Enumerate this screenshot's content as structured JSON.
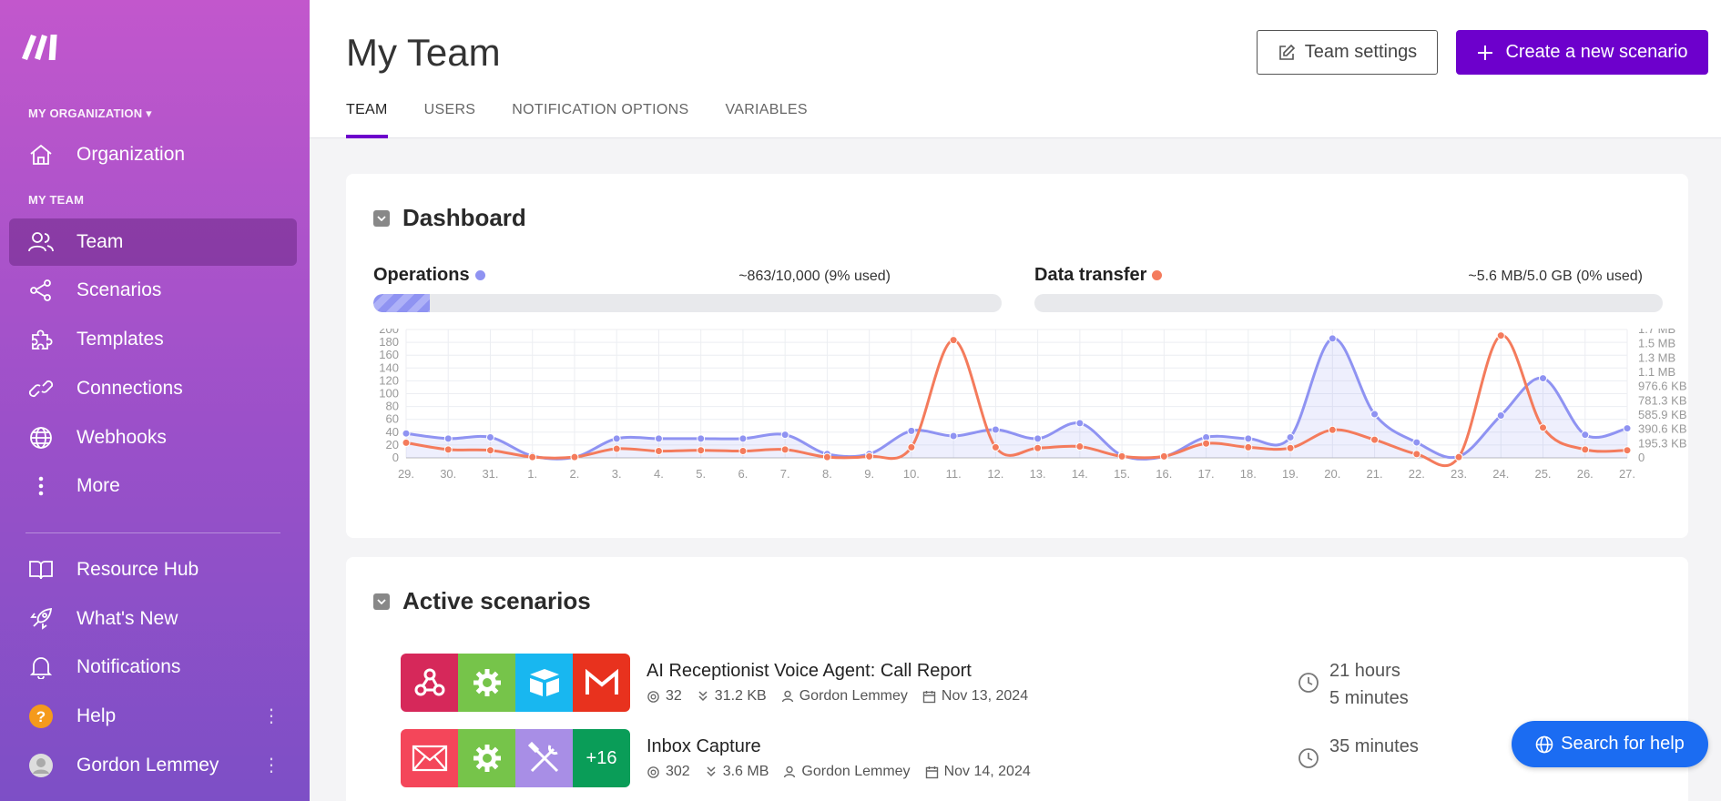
{
  "sidebar": {
    "org_label": "MY ORGANIZATION",
    "team_label": "MY TEAM",
    "items": [
      {
        "label": "Organization",
        "icon": "home-icon"
      },
      {
        "label": "Team",
        "icon": "users-icon"
      },
      {
        "label": "Scenarios",
        "icon": "share-icon"
      },
      {
        "label": "Templates",
        "icon": "puzzle-icon"
      },
      {
        "label": "Connections",
        "icon": "link-icon"
      },
      {
        "label": "Webhooks",
        "icon": "globe-icon"
      },
      {
        "label": "More",
        "icon": "dots-vertical-icon"
      }
    ],
    "bottom_items": [
      {
        "label": "Resource Hub",
        "icon": "book-icon"
      },
      {
        "label": "What's New",
        "icon": "rocket-icon"
      },
      {
        "label": "Notifications",
        "icon": "bell-icon"
      },
      {
        "label": "Help",
        "icon": "help-icon"
      },
      {
        "label": "Gordon Lemmey",
        "icon": "avatar"
      }
    ]
  },
  "header": {
    "title": "My Team",
    "settings_button": "Team settings",
    "create_button": "Create a new scenario",
    "tabs": [
      "TEAM",
      "USERS",
      "NOTIFICATION OPTIONS",
      "VARIABLES"
    ],
    "active_tab": "TEAM"
  },
  "dashboard": {
    "title": "Dashboard",
    "operations": {
      "label": "Operations",
      "value": "~863/10,000 (9% used)",
      "fraction": 0.09,
      "color": "#8f93f2"
    },
    "data_transfer": {
      "label": "Data transfer",
      "value": "~5.6 MB/5.0 GB (0% used)",
      "fraction": 0.0,
      "color": "#f47b5c"
    }
  },
  "chart_data": {
    "type": "line",
    "categories": [
      "29.",
      "30.",
      "31.",
      "1.",
      "2.",
      "3.",
      "4.",
      "5.",
      "6.",
      "7.",
      "8.",
      "9.",
      "10.",
      "11.",
      "12.",
      "13.",
      "14.",
      "15.",
      "16.",
      "17.",
      "18.",
      "19.",
      "20.",
      "21.",
      "22.",
      "23.",
      "24.",
      "25.",
      "26.",
      "27."
    ],
    "y_left_ticks": [
      "0",
      "20",
      "40",
      "60",
      "80",
      "100",
      "120",
      "140",
      "160",
      "180",
      "200"
    ],
    "y_left_range": [
      0,
      200
    ],
    "y_right_ticks": [
      "0",
      "195.3 KB",
      "390.6 KB",
      "585.9 KB",
      "781.3 KB",
      "976.6 KB",
      "1.1 MB",
      "1.3 MB",
      "1.5 MB",
      "1.7 MB"
    ],
    "y_right_range": [
      0,
      1.7
    ],
    "series": [
      {
        "name": "Operations",
        "axis": "left",
        "color": "#8f93f2",
        "values": [
          38,
          30,
          32,
          3,
          1,
          30,
          30,
          30,
          30,
          36,
          6,
          6,
          42,
          34,
          44,
          30,
          54,
          4,
          2,
          32,
          30,
          32,
          186,
          68,
          24,
          2,
          66,
          124,
          36,
          46
        ]
      },
      {
        "name": "Data transfer",
        "axis": "right",
        "color": "#f47b5c",
        "values": [
          0.2,
          0.11,
          0.1,
          0.01,
          0.01,
          0.12,
          0.09,
          0.1,
          0.09,
          0.11,
          0.01,
          0.02,
          0.14,
          1.56,
          0.14,
          0.13,
          0.15,
          0.02,
          0.02,
          0.19,
          0.14,
          0.13,
          0.37,
          0.24,
          0.05,
          0.01,
          1.62,
          0.4,
          0.11,
          0.1
        ]
      }
    ],
    "grid": true
  },
  "active_scenarios": {
    "title": "Active scenarios",
    "items": [
      {
        "name": "AI Receptionist Voice Agent: Call Report",
        "operations": "32",
        "data": "31.2 KB",
        "owner": "Gordon Lemmey",
        "date": "Nov 13, 2024",
        "time_line1": "21 hours",
        "time_line2": "5 minutes",
        "tiles": [
          {
            "icon": "webhook-icon",
            "color": "#d6285a"
          },
          {
            "icon": "gear-icon",
            "color": "#76c44a"
          },
          {
            "icon": "airtable-icon",
            "color": "#18b7f0"
          },
          {
            "icon": "gmail-icon",
            "color": "#e8321e"
          }
        ]
      },
      {
        "name": "Inbox Capture",
        "operations": "302",
        "data": "3.6 MB",
        "owner": "Gordon Lemmey",
        "date": "Nov 14, 2024",
        "time_line1": "",
        "time_line2": "35 minutes",
        "tiles": [
          {
            "icon": "email-icon",
            "color": "#f4465a"
          },
          {
            "icon": "gear-icon",
            "color": "#76c44a"
          },
          {
            "icon": "tools-icon",
            "color": "#a88ee6"
          },
          {
            "icon": "more-count",
            "label": "+16",
            "color": "#0a9d58"
          }
        ]
      }
    ]
  },
  "help_button": "Search for help"
}
